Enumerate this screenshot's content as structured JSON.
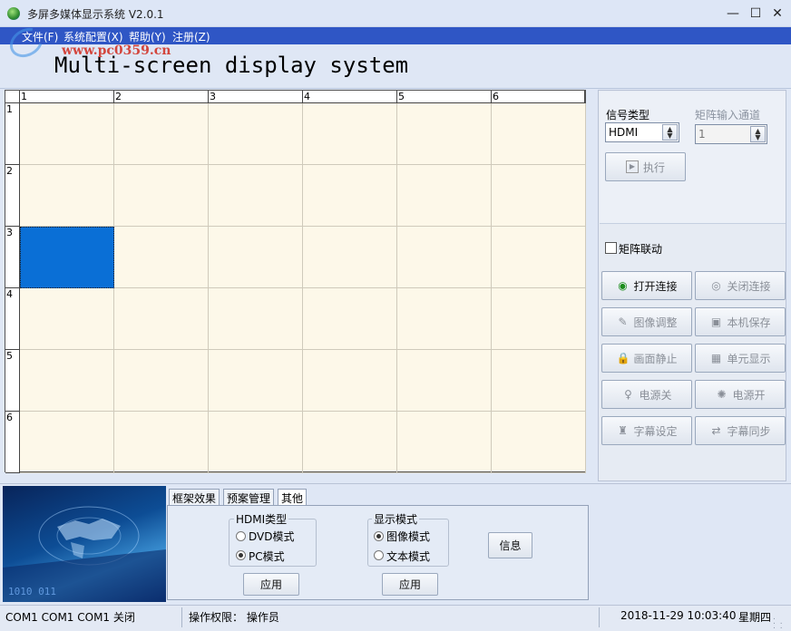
{
  "window": {
    "title": "多屏多媒体显示系统 V2.0.1",
    "minimize": "—",
    "maximize": "☐",
    "close": "✕"
  },
  "menu": {
    "items": [
      "文件(F)",
      "系统配置(X)",
      "帮助(Y)",
      "注册(Z)"
    ]
  },
  "watermark": {
    "text": "www.pc0359.cn",
    "color": "#d3463d"
  },
  "banner": {
    "title": "Multi-screen display system"
  },
  "grid": {
    "columns": [
      "1",
      "2",
      "3",
      "4",
      "5",
      "6"
    ],
    "rows": [
      "1",
      "2",
      "3",
      "4",
      "5",
      "6"
    ],
    "selected_cell": {
      "row": 3,
      "col": 1
    },
    "selected_color": "#0a6fd6",
    "background_color": "#fdf8e9"
  },
  "signal": {
    "type_label": "信号类型",
    "type_value": "HDMI",
    "channel_label": "矩阵输入通道",
    "channel_value": "1",
    "execute_label": "执行"
  },
  "matrix_link": {
    "label": "矩阵联动",
    "checked": false
  },
  "controls": [
    {
      "label": "打开连接",
      "icon": "connect-icon",
      "enabled": true
    },
    {
      "label": "关闭连接",
      "icon": "disconnect-icon",
      "enabled": false
    },
    {
      "label": "图像调整",
      "icon": "image-adjust-icon",
      "enabled": false
    },
    {
      "label": "本机保存",
      "icon": "save-icon",
      "enabled": false
    },
    {
      "label": "画面静止",
      "icon": "lock-icon",
      "enabled": false
    },
    {
      "label": "单元显示",
      "icon": "grid-icon",
      "enabled": false
    },
    {
      "label": "电源关",
      "icon": "bulb-off-icon",
      "enabled": false
    },
    {
      "label": "电源开",
      "icon": "bulb-on-icon",
      "enabled": false
    },
    {
      "label": "字幕设定",
      "icon": "subtitle-icon",
      "enabled": false
    },
    {
      "label": "字幕同步",
      "icon": "sync-icon",
      "enabled": false
    }
  ],
  "tabs": {
    "items": [
      "框架效果",
      "预案管理",
      "其他"
    ],
    "active": "其他"
  },
  "hdmi_type": {
    "title": "HDMI类型",
    "options": [
      "DVD模式",
      "PC模式"
    ],
    "selected": "PC模式",
    "apply": "应用"
  },
  "display_mode": {
    "title": "显示模式",
    "options": [
      "图像模式",
      "文本模式"
    ],
    "selected": "图像模式",
    "apply": "应用"
  },
  "info_button": "信息",
  "status": {
    "ports": "COM1 COM1 COM1 关闭",
    "permission": "操作权限：  操作员",
    "datetime": "2018-11-29 10:03:40",
    "weekday": "星期四"
  }
}
